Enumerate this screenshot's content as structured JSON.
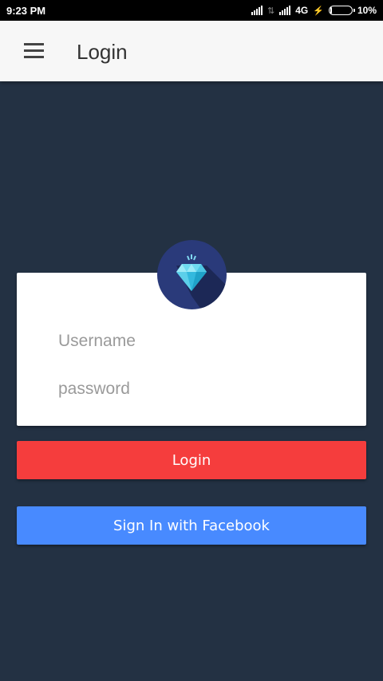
{
  "status_bar": {
    "time": "9:23 PM",
    "network": "4G",
    "battery_percent": "10%",
    "battery_level": 0.1
  },
  "app_bar": {
    "title": "Login",
    "menu_icon": "hamburger-menu-icon"
  },
  "avatar": {
    "icon": "diamond-icon",
    "background_color": "#2a3a7a"
  },
  "form": {
    "username_placeholder": "Username",
    "username_value": "",
    "password_placeholder": "password",
    "password_value": ""
  },
  "buttons": {
    "login_label": "Login",
    "facebook_label": "Sign In with Facebook"
  },
  "colors": {
    "background": "#233143",
    "login_button": "#f53d3d",
    "facebook_button": "#488aff",
    "app_bar": "#f7f7f7"
  }
}
